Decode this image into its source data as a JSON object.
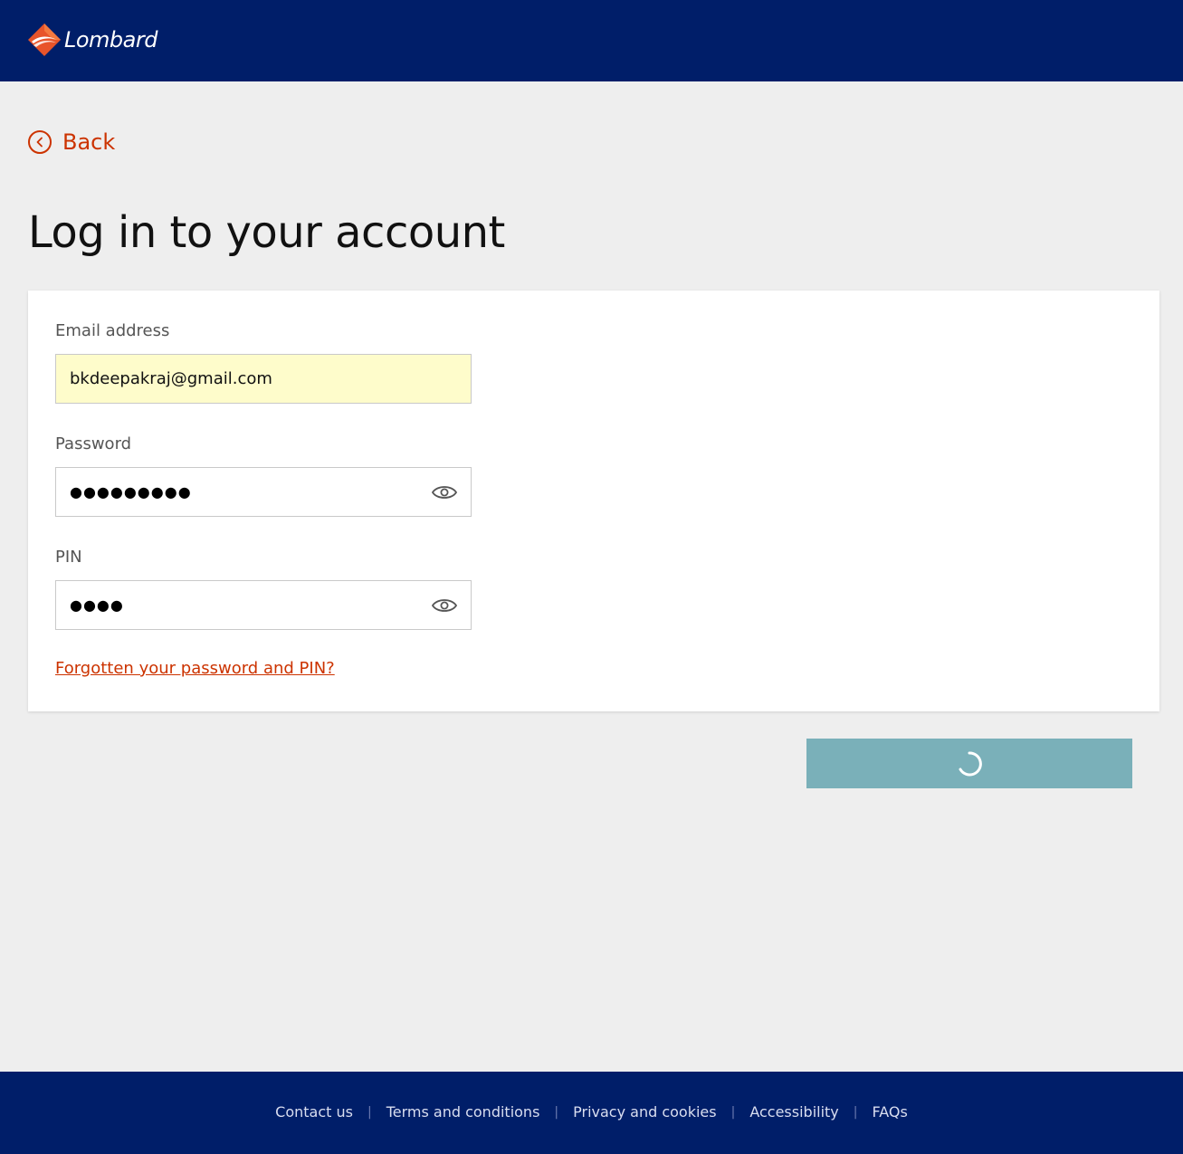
{
  "header": {
    "brand": "Lombard"
  },
  "back": {
    "label": "Back"
  },
  "page": {
    "title": "Log in to your account"
  },
  "form": {
    "email": {
      "label": "Email address",
      "value": "bkdeepakraj@gmail.com"
    },
    "password": {
      "label": "Password",
      "masked": "●●●●●●●●●"
    },
    "pin": {
      "label": "PIN",
      "masked": "●●●●"
    },
    "forgot_link": "Forgotten your password and PIN?"
  },
  "submit": {
    "state": "loading"
  },
  "footer": {
    "links": [
      "Contact us",
      "Terms and conditions",
      "Privacy and cookies",
      "Accessibility",
      "FAQs"
    ],
    "separator": "|"
  },
  "colors": {
    "header_bg": "#001e69",
    "accent": "#cc3300",
    "button_bg": "#7ab0b9",
    "autofill_bg": "#fefccb",
    "page_bg": "#eeeeee"
  },
  "icons": {
    "back": "chevron-left-circle-icon",
    "show_password": "eye-icon",
    "loading": "spinner-icon",
    "logo": "lombard-diamond-logo"
  }
}
